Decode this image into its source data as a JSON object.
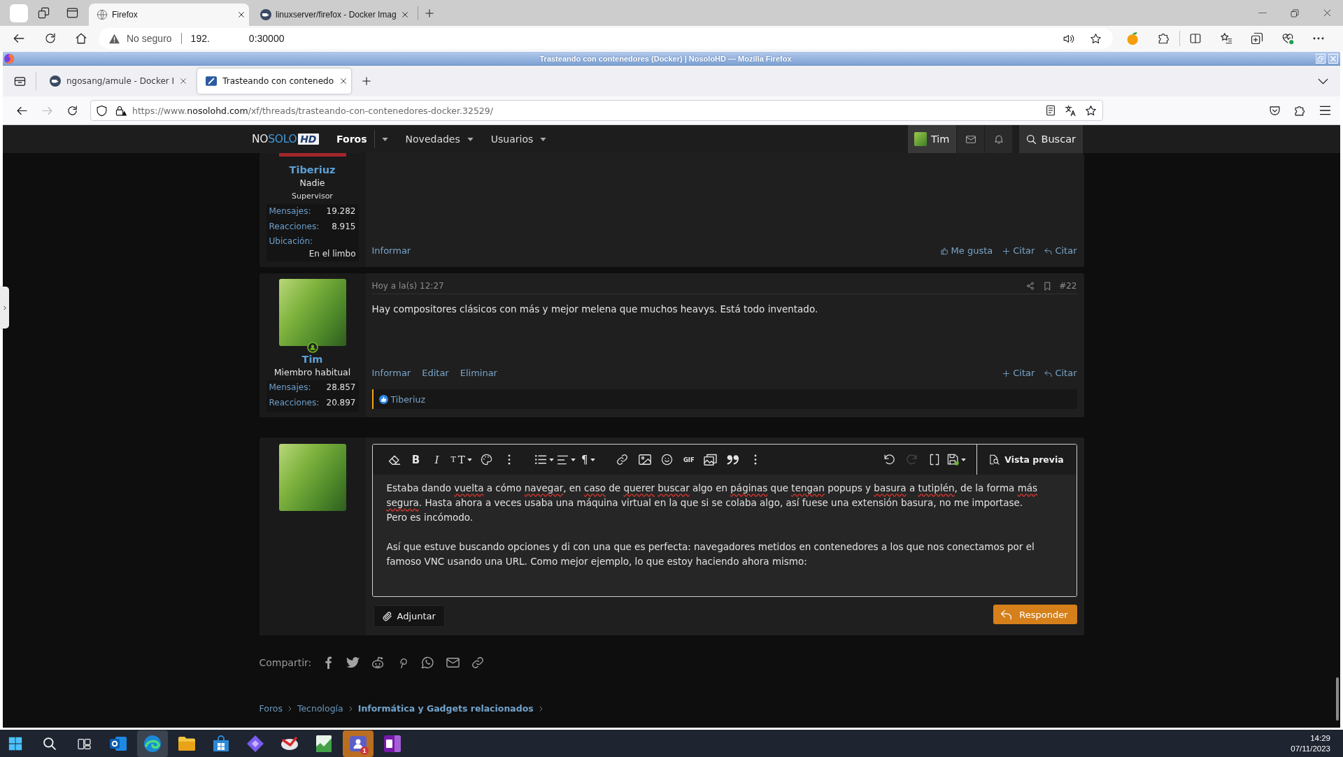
{
  "edge": {
    "tabs": [
      {
        "title": "Firefox",
        "kind": "globe",
        "selected": true
      },
      {
        "title": "linuxserver/firefox - Docker Imag",
        "kind": "round",
        "selected": false
      }
    ],
    "address": {
      "security": "No seguro",
      "host_start": "192.",
      "host_end": "0:30000"
    }
  },
  "firefox": {
    "title": "Trasteando con contenedores (Docker) | NosoloHD — Mozilla Firefox",
    "tabs": [
      {
        "title": "ngosang/amule - Docker I",
        "kind": "round",
        "selected": false
      },
      {
        "title": "Trasteando con contenedo",
        "kind": "square",
        "selected": true
      }
    ],
    "forward": {
      "disabled": true
    },
    "url": {
      "scheme": "https://www.",
      "domain": "nosolohd.com",
      "path": "/xf/threads/trasteando-con-contenedores-docker.32529/"
    }
  },
  "forum_nav": {
    "logo": [
      {
        "text": "NO",
        "kind": "plain"
      },
      {
        "text": "SOLO",
        "kind": "accent"
      },
      {
        "text": "HD",
        "kind": "boxed"
      }
    ],
    "items": [
      {
        "label": "Foros",
        "selected": true
      },
      {
        "label": "Novedades",
        "selected": false
      },
      {
        "label": "Usuarios",
        "selected": false
      }
    ],
    "account": {
      "name": "Tim"
    },
    "search": {
      "label": "Buscar"
    }
  },
  "posts": [
    {
      "author": {
        "name": "Tiberiuz",
        "title": "Nadie",
        "banner": "Supervisor",
        "stats": [
          {
            "label": "Mensajes:",
            "value": "19.282",
            "kind": "inline"
          },
          {
            "label": "Reacciones:",
            "value": "8.915",
            "kind": "inline"
          },
          {
            "label": "Ubicación:",
            "value": "En el limbo",
            "kind": "stacked"
          }
        ]
      },
      "actions": [
        {
          "label": "Informar"
        }
      ],
      "reply_actions": [
        {
          "kind": "like",
          "label": "Me gusta"
        },
        {
          "kind": "multiquote",
          "label": "Citar"
        },
        {
          "kind": "quote",
          "label": "Citar"
        }
      ]
    },
    {
      "date": "Hoy a la(s) 12:27",
      "number": "#22",
      "body": "Hay compositores clásicos con más y mejor melena que muchos heavys. Está todo inventado.",
      "author": {
        "name": "Tim",
        "title": "Miembro habitual",
        "online": true,
        "stats": [
          {
            "label": "Mensajes:",
            "value": "28.857",
            "kind": "inline"
          },
          {
            "label": "Reacciones:",
            "value": "20.897",
            "kind": "inline"
          }
        ]
      },
      "actions": [
        {
          "label": "Informar"
        },
        {
          "label": "Editar"
        },
        {
          "label": "Eliminar"
        }
      ],
      "reply_actions": [
        {
          "kind": "multiquote",
          "label": "Citar"
        },
        {
          "kind": "quote",
          "label": "Citar"
        }
      ],
      "reactions": {
        "users": "Tiberiuz"
      }
    }
  ],
  "reply": {
    "toolbar": [
      [
        {
          "kind": "eraser",
          "disabled": false
        },
        {
          "kind": "bold",
          "label": "B",
          "disabled": false
        },
        {
          "kind": "italic",
          "label": "I",
          "disabled": false
        },
        {
          "kind": "text_size",
          "label": "TT",
          "disabled": false
        },
        {
          "kind": "palette",
          "disabled": false
        },
        {
          "kind": "more",
          "disabled": false
        }
      ],
      [
        {
          "kind": "list",
          "disabled": false
        },
        {
          "kind": "align",
          "disabled": false
        },
        {
          "kind": "paragraph",
          "label": "¶",
          "disabled": false
        }
      ],
      [
        {
          "kind": "link",
          "disabled": false
        },
        {
          "kind": "image",
          "disabled": false
        },
        {
          "kind": "emoji",
          "disabled": false
        },
        {
          "kind": "gif",
          "label": "GIF",
          "disabled": false
        },
        {
          "kind": "gallery",
          "disabled": false
        },
        {
          "kind": "quote",
          "disabled": false
        },
        {
          "kind": "more",
          "disabled": false
        }
      ]
    ],
    "toolbar_end": [
      {
        "kind": "undo",
        "disabled": false
      },
      {
        "kind": "redo",
        "disabled": true
      },
      {
        "kind": "bbcode",
        "disabled": false
      },
      {
        "kind": "drafts",
        "disabled": false
      }
    ],
    "preview": "Vista previa",
    "paragraphs": [
      {
        "segments": [
          {
            "text": "Estaba dando ",
            "misspelled": false
          },
          {
            "text": "vuelta",
            "misspelled": true
          },
          {
            "text": " a cómo ",
            "misspelled": false
          },
          {
            "text": "navegar",
            "misspelled": true
          },
          {
            "text": ", en ",
            "misspelled": false
          },
          {
            "text": "caso",
            "misspelled": true
          },
          {
            "text": " de ",
            "misspelled": false
          },
          {
            "text": "querer buscar",
            "misspelled": true
          },
          {
            "text": " algo en ",
            "misspelled": false
          },
          {
            "text": "páginas",
            "misspelled": true
          },
          {
            "text": " que ",
            "misspelled": false
          },
          {
            "text": "tengan",
            "misspelled": true
          },
          {
            "text": " popups y ",
            "misspelled": false
          },
          {
            "text": "basura",
            "misspelled": true
          },
          {
            "text": " a ",
            "misspelled": false
          },
          {
            "text": "tutiplén",
            "misspelled": true
          },
          {
            "text": ", de la forma ",
            "misspelled": false
          },
          {
            "text": "más segura",
            "misspelled": true
          },
          {
            "text": ". Hasta ahora a veces usaba una máquina virtual en la que si se colaba algo, así fuese una extensión basura, no me importase. Pero es incómodo.",
            "misspelled": false
          }
        ]
      },
      {
        "segments": [
          {
            "text": "Así que estuve buscando opciones y di con una que es perfecta: navegadores metidos en contenedores a los que nos conectamos por el famoso VNC usando una URL. Como mejor ejemplo, lo que estoy haciendo ahora mismo:",
            "misspelled": false
          }
        ]
      }
    ],
    "attach": "Adjuntar",
    "submit": "Responder"
  },
  "share": {
    "label": "Compartir:",
    "services": [
      {
        "kind": "facebook"
      },
      {
        "kind": "twitter"
      },
      {
        "kind": "reddit"
      },
      {
        "kind": "pinterest"
      },
      {
        "kind": "whatsapp"
      },
      {
        "kind": "email"
      },
      {
        "kind": "link"
      }
    ]
  },
  "breadcrumb": [
    {
      "label": "Foros",
      "current": false
    },
    {
      "label": "Tecnología",
      "current": false
    },
    {
      "label": "Informática y Gadgets relacionados",
      "current": true
    }
  ],
  "taskbar": {
    "apps": [
      {
        "kind": "mail",
        "active": false,
        "flashing": false
      },
      {
        "kind": "browser",
        "active": true,
        "flashing": false
      },
      {
        "kind": "folder",
        "active": false,
        "flashing": false
      },
      {
        "kind": "store",
        "active": false,
        "flashing": false
      },
      {
        "kind": "diamond",
        "active": false,
        "flashing": false
      },
      {
        "kind": "swirl",
        "active": false,
        "flashing": false
      },
      {
        "kind": "notepad",
        "active": false,
        "flashing": false
      },
      {
        "kind": "chat",
        "active": false,
        "flashing": true,
        "badge": "1"
      },
      {
        "kind": "notebook",
        "active": false,
        "flashing": false
      }
    ],
    "time": "14:29",
    "date": "07/11/2023"
  }
}
